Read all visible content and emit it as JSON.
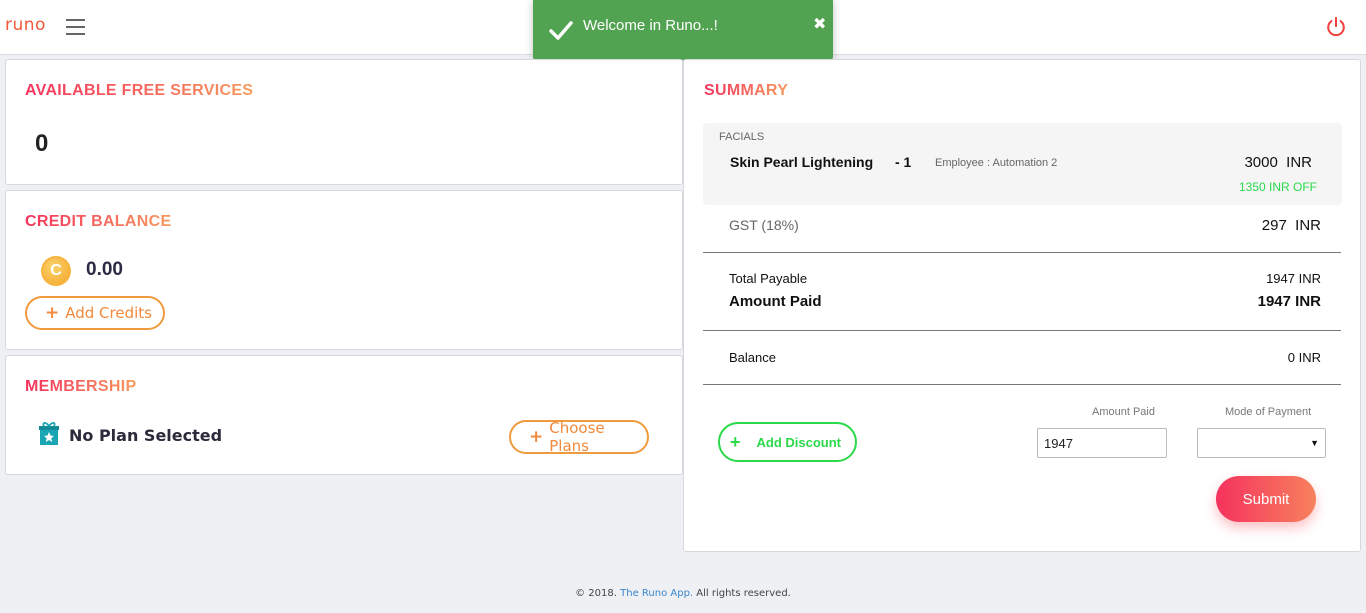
{
  "header": {
    "logo": "runo",
    "menu_icon": "hamburger-icon",
    "power_icon": "power-icon"
  },
  "toast": {
    "message": "Welcome in Runo...!",
    "close": "✖"
  },
  "free_services": {
    "title": "AVAILABLE FREE SERVICES",
    "count": "0"
  },
  "credit": {
    "title": "CREDIT BALANCE",
    "coin_glyph": "C",
    "balance": "0.00",
    "add_label": "Add Credits"
  },
  "membership": {
    "title": "MEMBERSHIP",
    "plan": "No Plan Selected",
    "choose_label": "Choose Plans"
  },
  "summary": {
    "title": "SUMMARY",
    "category": "FACIALS",
    "service_name": "Skin Pearl Lightening",
    "service_qty": "- 1",
    "employee": "Employee : Automation 2",
    "service_price": "3000  INR",
    "discount_note": "1350 INR OFF",
    "gst_label": "GST (18%)",
    "gst_value": "297  INR",
    "total_label": "Total Payable",
    "total_value": "1947 INR",
    "paid_label": "Amount Paid",
    "paid_value": "1947 INR",
    "balance_label": "Balance",
    "balance_value": "0 INR",
    "add_discount_label": "Add Discount",
    "amount_paid_field_label": "Amount Paid",
    "amount_paid_value": "1947",
    "mode_label": "Mode of Payment",
    "mode_value": "",
    "submit_label": "Submit"
  },
  "footer": {
    "prefix": "© 2018.",
    "link": "The Runo App.",
    "suffix": "All rights reserved."
  },
  "colors": {
    "accent_start": "#f5325e",
    "accent_end": "#f7995d",
    "toast_green": "#51a351",
    "discount_green": "#2bd94a"
  }
}
